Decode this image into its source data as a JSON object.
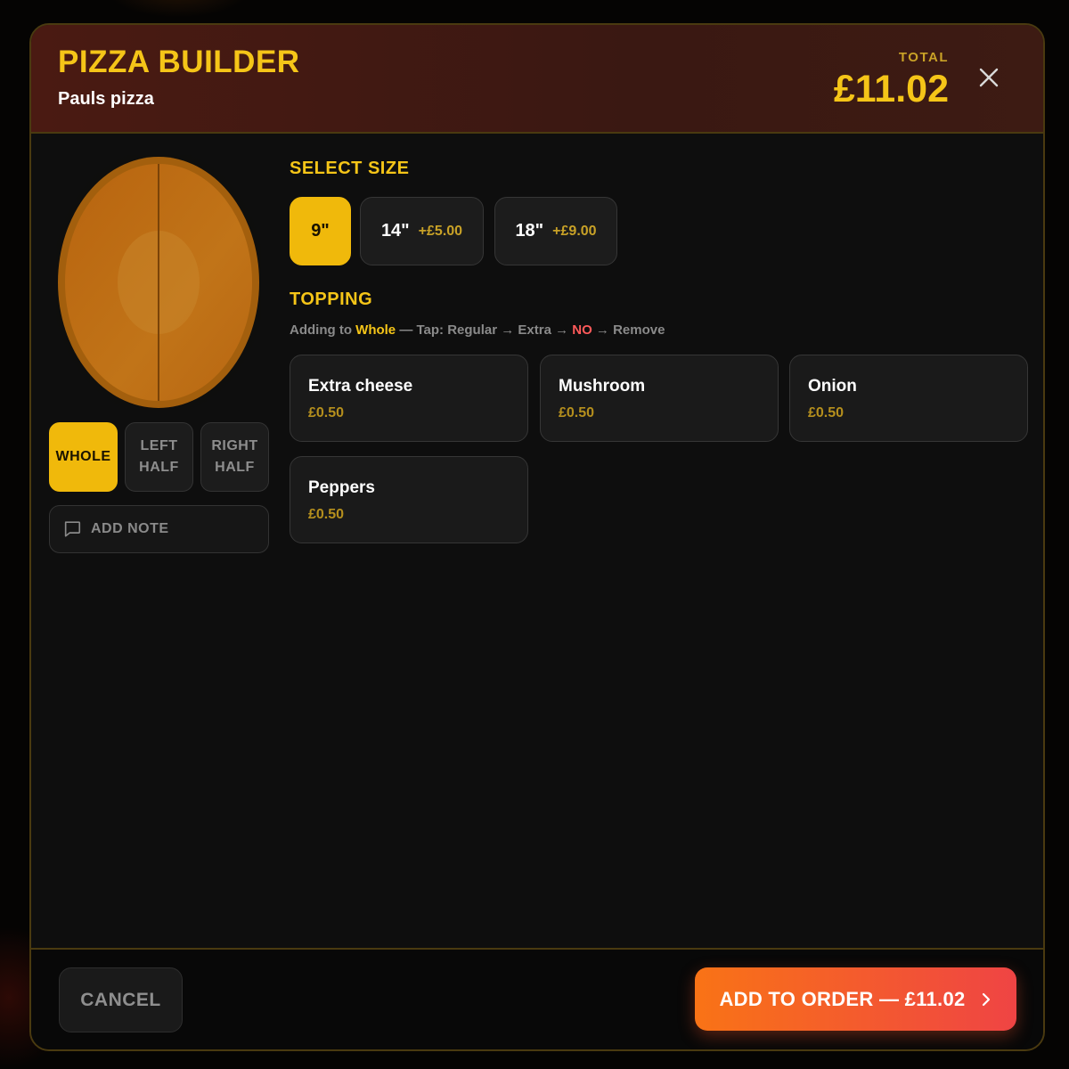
{
  "header": {
    "title": "PIZZA BUILDER",
    "subtitle": "Pauls pizza",
    "total_label": "TOTAL",
    "total_value": "£11.02",
    "close_icon": "close-icon"
  },
  "colors": {
    "accent": "#f5c518",
    "active_button": "#f0b90b",
    "price": "#b58f1d",
    "remove": "#ff5a5a",
    "cta_gradient_start": "#f97316",
    "cta_gradient_end": "#ef4444",
    "crust": "#a35f0d"
  },
  "pizza": {
    "modes": [
      {
        "line1": "WHOLE",
        "line2": "",
        "active": true
      },
      {
        "line1": "LEFT",
        "line2": "HALF",
        "active": false
      },
      {
        "line1": "RIGHT",
        "line2": "HALF",
        "active": false
      }
    ],
    "note_label": "ADD NOTE",
    "note_icon": "message-square-icon"
  },
  "size": {
    "label": "SELECT SIZE",
    "options": [
      {
        "label": "9\"",
        "extra": "",
        "selected": true
      },
      {
        "label": "14\"",
        "extra": "+£5.00",
        "selected": false
      },
      {
        "label": "18\"",
        "extra": "+£9.00",
        "selected": false
      }
    ]
  },
  "topping": {
    "label": "TOPPING",
    "hint": {
      "prefix": "Adding to ",
      "target": "Whole",
      "middle": " — Tap: Regular → Extra → ",
      "no": "NO",
      "suffix": " → Remove"
    },
    "items": [
      {
        "name": "Extra cheese",
        "price": "£0.50"
      },
      {
        "name": "Mushroom",
        "price": "£0.50"
      },
      {
        "name": "Onion",
        "price": "£0.50"
      },
      {
        "name": "Peppers",
        "price": "£0.50"
      }
    ]
  },
  "footer": {
    "cancel_label": "CANCEL",
    "add_label": "ADD TO ORDER — £11.02",
    "chevron_icon": "chevron-right-icon"
  }
}
